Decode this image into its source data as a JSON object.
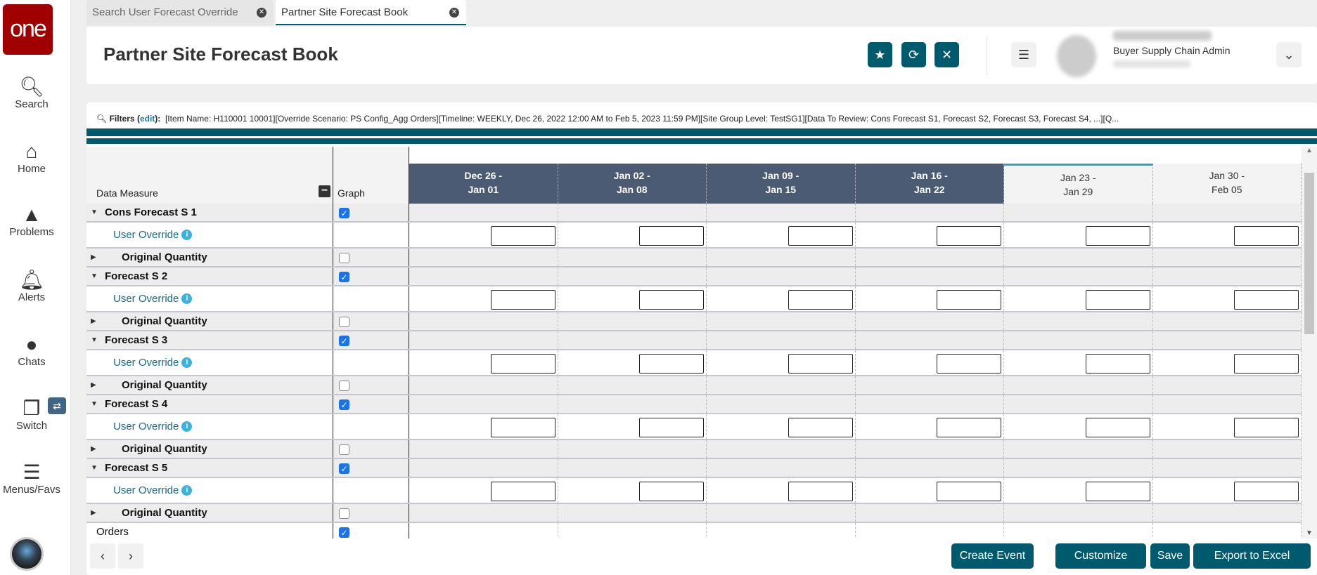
{
  "sidebar": {
    "logo": "one",
    "items": [
      {
        "label": "Search",
        "icon": "search-icon",
        "glyph": "🔍︎"
      },
      {
        "label": "Home",
        "icon": "home-icon",
        "glyph": "⌂"
      },
      {
        "label": "Problems",
        "icon": "warning-icon",
        "glyph": "▲"
      },
      {
        "label": "Alerts",
        "icon": "bell-icon",
        "glyph": "🔔︎"
      },
      {
        "label": "Chats",
        "icon": "chat-icon",
        "glyph": "●"
      },
      {
        "label": "Switch",
        "icon": "switch-icon",
        "glyph": "❐"
      },
      {
        "label": "Menus/Favs",
        "icon": "menu-icon",
        "glyph": "☰"
      }
    ]
  },
  "tabs": [
    {
      "label": "Search User Forecast Override"
    },
    {
      "label": "Partner Site Forecast Book",
      "active": true
    }
  ],
  "header": {
    "title": "Partner Site Forecast Book",
    "role": "Buyer Supply Chain Admin"
  },
  "filters": {
    "label": "Filters",
    "edit": "edit",
    "text": "[Item Name: H110001              10001][Override Scenario: PS Config_Agg Orders][Timeline: WEEKLY, Dec 26, 2022 12:00 AM to Feb 5, 2023 11:59 PM][Site Group Level: TestSG1][Data To Review: Cons Forecast S1, Forecast S2, Forecast S3, Forecast S4, ...][Q..."
  },
  "grid": {
    "col_measure": "Data Measure",
    "col_graph": "Graph",
    "weeks": [
      {
        "l1": "Dec 26 -",
        "l2": "Jan 01",
        "style": "dark"
      },
      {
        "l1": "Jan 02 -",
        "l2": "Jan 08",
        "style": "dark"
      },
      {
        "l1": "Jan 09 -",
        "l2": "Jan 15",
        "style": "dark"
      },
      {
        "l1": "Jan 16 -",
        "l2": "Jan 22",
        "style": "dark"
      },
      {
        "l1": "Jan 23 -",
        "l2": "Jan 29",
        "style": "light",
        "selected": true
      },
      {
        "l1": "Jan 30 -",
        "l2": "Feb 05",
        "style": "light"
      }
    ],
    "groups": [
      {
        "name": "Cons Forecast S 1",
        "checked": true
      },
      {
        "name": "Forecast S 2",
        "checked": true
      },
      {
        "name": "Forecast S 3",
        "checked": true
      },
      {
        "name": "Forecast S 4",
        "checked": true
      },
      {
        "name": "Forecast S 5",
        "checked": true
      }
    ],
    "override_label": "User Override",
    "original_label": "Original Quantity",
    "original_checked": false,
    "last_row": {
      "name": "Orders",
      "checked": true
    }
  },
  "footer": {
    "create_event": "Create Event",
    "customize": "Customize",
    "save": "Save",
    "export": "Export to Excel"
  },
  "colors": {
    "teal": "#005a6e",
    "header_dark": "#4a5b73",
    "brand": "#a00000"
  }
}
